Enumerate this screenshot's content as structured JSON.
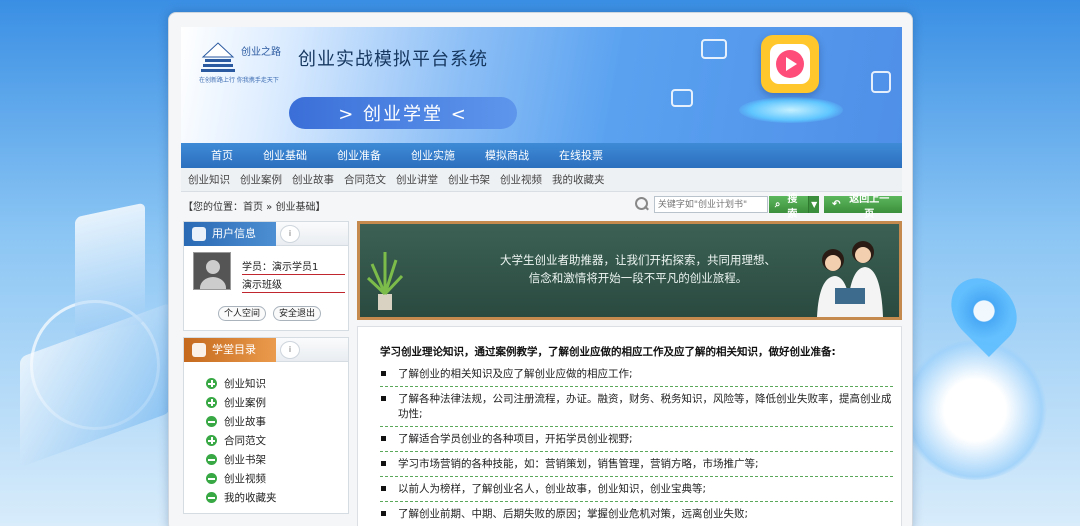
{
  "header": {
    "logo_name": "创业之路",
    "logo_tagline": "在创新路上行  你我携手走天下",
    "site_title": "创业实战模拟平台系统",
    "section_title": "> 创业学堂 <"
  },
  "nav": {
    "items": [
      {
        "label": "首页"
      },
      {
        "label": "创业基础"
      },
      {
        "label": "创业准备"
      },
      {
        "label": "创业实施"
      },
      {
        "label": "模拟商战"
      },
      {
        "label": "在线投票"
      }
    ]
  },
  "subnav": {
    "items": [
      {
        "label": "创业知识"
      },
      {
        "label": "创业案例"
      },
      {
        "label": "创业故事"
      },
      {
        "label": "合同范文"
      },
      {
        "label": "创业讲堂"
      },
      {
        "label": "创业书架"
      },
      {
        "label": "创业视频"
      },
      {
        "label": "我的收藏夹"
      }
    ]
  },
  "breadcrumb": {
    "text": "【您的位置：首页 » 创业基础】"
  },
  "search": {
    "placeholder": "关键字如\"创业计划书\"",
    "button": "搜索",
    "back_button": "返回上一页"
  },
  "user_panel": {
    "title": "用户信息",
    "student": "学员：演示学员1",
    "class": "演示班级",
    "space_button": "个人空间",
    "logout_button": "安全退出"
  },
  "course_panel": {
    "title": "学堂目录",
    "items": [
      {
        "label": "创业知识",
        "icon": "plus"
      },
      {
        "label": "创业案例",
        "icon": "plus"
      },
      {
        "label": "创业故事",
        "icon": "minus"
      },
      {
        "label": "合同范文",
        "icon": "plus"
      },
      {
        "label": "创业书架",
        "icon": "minus"
      },
      {
        "label": "创业视频",
        "icon": "minus"
      },
      {
        "label": "我的收藏夹",
        "icon": "minus"
      }
    ]
  },
  "hero": {
    "line1": "大学生创业者助推器，让我们开拓探索，共同用理想、",
    "line2": "信念和激情将开始一段不平凡的创业旅程。"
  },
  "content": {
    "lead": "学习创业理论知识，通过案例教学，了解创业应做的相应工作及应了解的相关知识，做好创业准备:",
    "items": [
      "了解创业的相关知识及应了解创业应做的相应工作;",
      "了解各种法律法规，公司注册流程，办证。融资，财务、税务知识，风险等，降低创业失败率，提高创业成功性;",
      "了解适合学员创业的各种项目，开拓学员创业视野;",
      "学习市场营销的各种技能，如：营销策划，销售管理，营销方略，市场推广等;",
      "以前人为榜样，了解创业名人，创业故事，创业知识，创业宝典等;",
      "了解创业前期、中期、后期失败的原因；掌握创业危机对策，远离创业失败;"
    ]
  },
  "colors": {
    "nav_blue": "#2b6fbf",
    "green_button": "#3c8f3c",
    "orange_tab": "#c4691d",
    "chalkboard": "#2e5046"
  }
}
